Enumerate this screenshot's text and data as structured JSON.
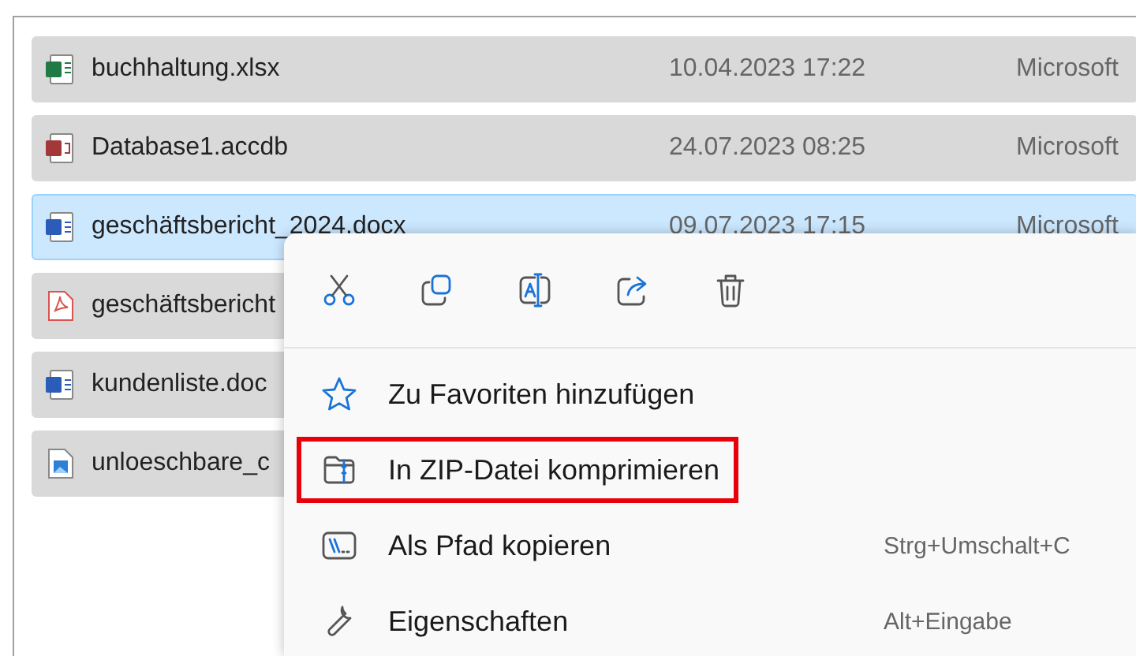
{
  "files": [
    {
      "kind": "excel",
      "name": "buchhaltung.xlsx",
      "date": "10.04.2023 17:22",
      "type": "Microsoft",
      "selected": false
    },
    {
      "kind": "access",
      "name": "Database1.accdb",
      "date": "24.07.2023 08:25",
      "type": "Microsoft",
      "selected": false
    },
    {
      "kind": "word",
      "name": "geschäftsbericht_2024.docx",
      "date": "09.07.2023 17:15",
      "type": "Microsoft",
      "selected": true
    },
    {
      "kind": "pdf",
      "name": "geschäftsbericht",
      "selected": false
    },
    {
      "kind": "word",
      "name": "kundenliste.doc",
      "selected": false
    },
    {
      "kind": "image",
      "name": "unloeschbare_c",
      "selected": false
    }
  ],
  "context_menu": {
    "toolbar": [
      {
        "kind": "cut"
      },
      {
        "kind": "copy"
      },
      {
        "kind": "rename"
      },
      {
        "kind": "share"
      },
      {
        "kind": "delete"
      }
    ],
    "items": [
      {
        "kind": "star",
        "label": "Zu Favoriten hinzufügen",
        "highlighted": false
      },
      {
        "kind": "zip",
        "label": "In ZIP-Datei komprimieren",
        "highlighted": true
      },
      {
        "kind": "path",
        "label": "Als Pfad kopieren",
        "shortcut": "Strg+Umschalt+C",
        "highlighted": false
      },
      {
        "kind": "wrench",
        "label": "Eigenschaften",
        "shortcut": "Alt+Eingabe",
        "highlighted": false
      }
    ]
  }
}
